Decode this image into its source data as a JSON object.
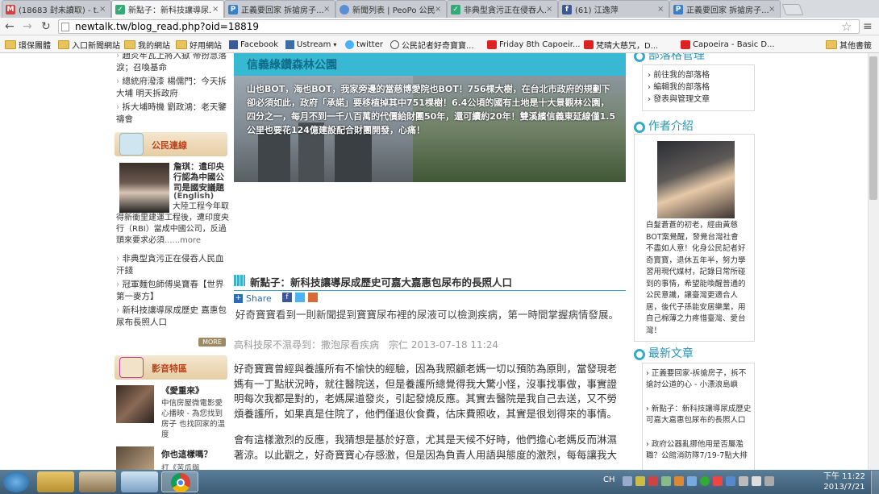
{
  "tabs": [
    {
      "label": "(18683 封未讀取) - t..."
    },
    {
      "label": "新點子：新科技讓導尿..."
    },
    {
      "label": "正義要回家 拆搶房子..."
    },
    {
      "label": "新聞列表 | PeoPo 公民..."
    },
    {
      "label": "非典型貪污正在侵吞人..."
    },
    {
      "label": "(61) 江逸萍"
    },
    {
      "label": "正義要回家 拆搶房子..."
    }
  ],
  "url": "newtalk.tw/blog_read.php?oid=18819",
  "bookmarks": [
    "環保團體",
    "入口新聞網站",
    "我的網站",
    "好用網站",
    "Facebook",
    "Ustream",
    "twitter",
    "公民記者好奇寶寶...",
    "Friday 8th Capoeir...",
    "梵晴大慈咒，D...",
    "Capoeira - Basic D...",
    "其他書籤"
  ],
  "left": {
    "top_items": [
      "趙炎牢瓦上將入獄 帝扮急落淚；召喚基命",
      "總統府潑漆 楊儒門：今天拆大埔 明天拆政府",
      "拆大埔時機 劉政鴻：老天鑒禱會"
    ],
    "citizen_title": "公民連線",
    "citizen_feature_title": "詹琪：遣印央行認為中國公司是國安議題",
    "citizen_feature_sub": "(English)",
    "citizen_feature_body": "大陸工程今年取得新衝里建運工程後，遭印度央行（RBI）當成中國公司，反過頭來要求必須",
    "more_text": "......more",
    "citizen_list": [
      "非典型貪污正在侵吞人民血汗錢",
      "冠軍麵包師傅吳寶春【世界第一麥方】",
      "新科技讓導尿成歷史 嘉惠包尿布長照人口"
    ],
    "more_badge": "MORE",
    "video_title": "影音特區",
    "video1_title": "《愛重來》",
    "video1_body": "中信房屋微電影愛心播映 - 為您找到房子 也找回家的溫度",
    "video2_title": "你也這樣嗎？",
    "video2_body": "打《苦瓜與"
  },
  "center": {
    "banner_title": "信義綠鑽森林公園",
    "banner_text": "山也BOT，海也BOT，我家旁邊的當慈博愛院也BOT！756棵大樹，在台北市政府的規劃下卻必須如此，政府「承諾」要移植掉其中751棵樹！6.4公頃的國有土地是十大景觀林公園，四分之一，每月不到一千八百萬的代價給財團50年，還可續約20年！雙溪繽信義東延線僅1.5公里也要花124億建設配合財團開發，心痛！",
    "article_title": "新點子：新科技讓導尿成歷史可嘉大嘉惠包尿布的長照人口",
    "share_label": "Share",
    "lead": "好奇寶寶看到一則新聞提到寶寶尿布裡的尿液可以檢測疾病，第一時間掌握病情發展。",
    "tags": "高科技尿不濕尋到：撒泡尿看疾病",
    "author_date": "宗仁 2013-07-18 11:24",
    "para1": "好奇寶寶曾經與養護所有不愉快的經驗，因為我照顧老媽一切以預防為原則，當發現老媽有一丁點狀況時，就往醫院送，但是養護所總覺得我大驚小怪，沒事找事做，事實證明每次我都是對的，老媽屎道發炎，引起發燒反應。其實去醫院是我自己去送，又不勞煩養護所，如果真是住院了，他們僅退伙食費，估床費照收，其實是很划得來的事情。",
    "para2": "會有這樣激烈的反應，我猜想是基於好意，尤其是天候不好時，他們擔心老媽反而淋濕著涼。以此觀之，好奇寶寶心存感激，但是因為負責人用語與態度的激烈，每每讓我大"
  },
  "right": {
    "blog_title": "部落格管理",
    "blog_links": [
      "前往我的部落格",
      "編輯我的部落格",
      "發表與管理文章"
    ],
    "author_title": "作者介紹",
    "author_bio": "白髮蒼蒼的初老，經由黃慈BOT案覺醒，發覺台灣社會不盡如人意！化身公民記者好奇寶寶，退休五年半，努力學習用現代媒材，記錄日常所碰到的事情，希望能喚醒普通的公民意識，讓臺灣更適合人居，後代子孫能安居樂業，用自己棉薄之力疼惜臺灣、愛台灣！",
    "latest_title": "最新文章",
    "latest_list": [
      "正義要回家-拆搶房子，拆不搶討公道的心 - 小漂浪島嶼",
      "新點子：新科技讓導尿成歷史可嘉大嘉惠包尿布的長照人口",
      "政府公器亂挪他用是否屬濫職？公館消防隊7/19-7點大排"
    ]
  },
  "taskbar": {
    "lang": "CH",
    "time": "下午 11:22",
    "date": "2013/7/21"
  }
}
